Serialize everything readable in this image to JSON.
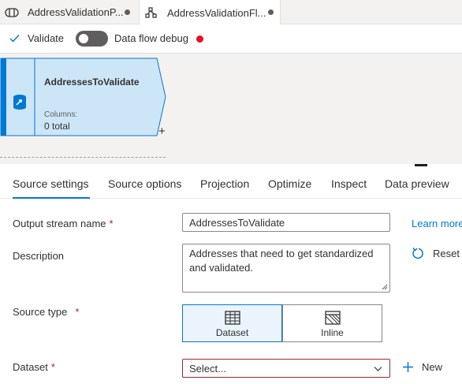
{
  "tabs": [
    {
      "label": "AddressValidationP...",
      "icon": "pipeline-icon",
      "unsaved": true
    },
    {
      "label": "AddressValidationFl...",
      "icon": "dataflow-icon",
      "unsaved": true,
      "active": true
    }
  ],
  "toolbar": {
    "validate_label": "Validate",
    "debug_label": "Data flow debug",
    "debug_on": false,
    "debug_status_color": "#e81123"
  },
  "node": {
    "title": "AddressesToValidate",
    "columns_label": "Columns:",
    "columns_value": "0 total",
    "add_label": "+",
    "accent_color": "#0078d4",
    "fill_color": "#cde6f7"
  },
  "settings_tabs": [
    "Source settings",
    "Source options",
    "Projection",
    "Optimize",
    "Inspect",
    "Data preview"
  ],
  "form": {
    "output_stream": {
      "label": "Output stream name",
      "required": "*",
      "value": "AddressesToValidate"
    },
    "description": {
      "label": "Description",
      "value": "Addresses that need to get standardized and validated."
    },
    "source_type": {
      "label": "Source type",
      "required": "*",
      "options": [
        "Dataset",
        "Inline"
      ],
      "selected": "Dataset"
    },
    "dataset": {
      "label": "Dataset",
      "required": "*",
      "placeholder": "Select..."
    },
    "learn_more": "Learn more",
    "reset": "Reset",
    "new": "New"
  }
}
